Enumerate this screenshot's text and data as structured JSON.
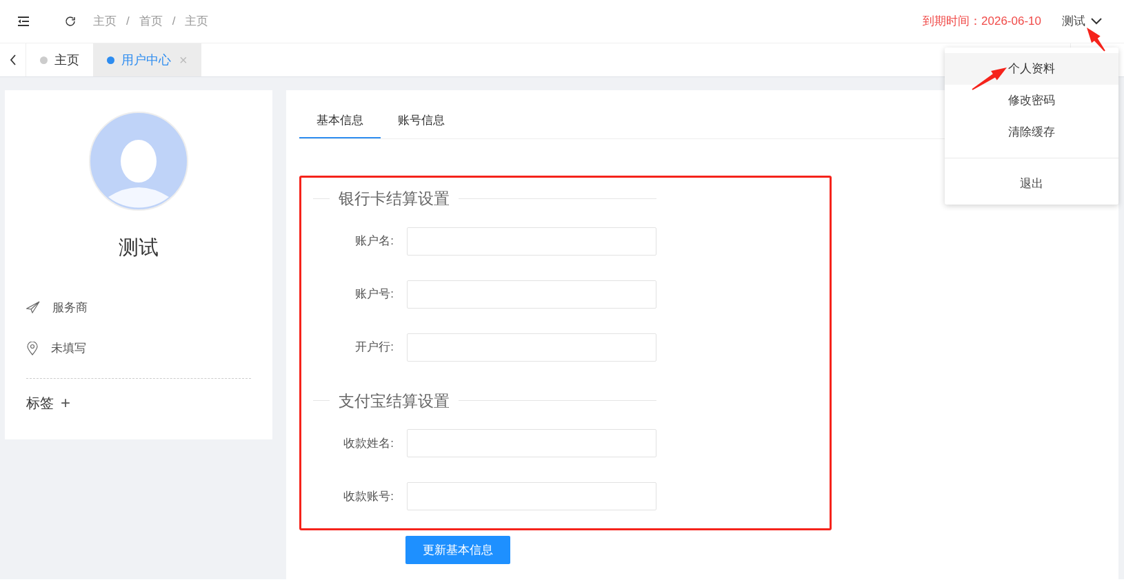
{
  "header": {
    "breadcrumb": [
      "主页",
      "首页",
      "主页"
    ],
    "separator": "/",
    "expiry": "到期时间：2026-06-10",
    "user": "测试"
  },
  "tabs": [
    {
      "label": "主页",
      "selected": false,
      "closable": false
    },
    {
      "label": "用户中心",
      "selected": true,
      "closable": true
    }
  ],
  "close_glyph": "×",
  "user_menu": {
    "items": [
      {
        "label": "个人资料",
        "highlighted": true,
        "divided": false
      },
      {
        "label": "修改密码",
        "highlighted": false,
        "divided": false
      },
      {
        "label": "清除缓存",
        "highlighted": false,
        "divided": false
      },
      {
        "label": "退出",
        "highlighted": false,
        "divided": true
      }
    ]
  },
  "profile": {
    "name": "测试",
    "info": [
      {
        "kind": "role",
        "text": "服务商"
      },
      {
        "kind": "location",
        "text": "未填写"
      }
    ],
    "tags_label": "标签",
    "add_glyph": "+"
  },
  "content_tabs": [
    {
      "label": "基本信息",
      "selected": true
    },
    {
      "label": "账号信息",
      "selected": false
    }
  ],
  "annotation_frame": true,
  "sections": [
    {
      "legend": "银行卡结算设置",
      "fields": [
        {
          "label": "账户名:"
        },
        {
          "label": "账户号:"
        },
        {
          "label": "开户行:"
        }
      ]
    },
    {
      "legend": "支付宝结算设置",
      "fields": [
        {
          "label": "收款姓名:"
        },
        {
          "label": "收款账号:"
        }
      ]
    }
  ],
  "submit": "更新基本信息",
  "annotation_arrows": [
    {
      "kind": "arrow"
    },
    {
      "kind": "arrow"
    }
  ]
}
